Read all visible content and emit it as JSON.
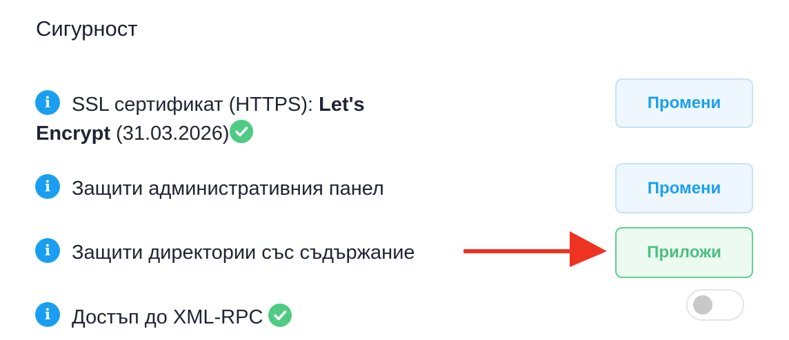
{
  "section": {
    "title": "Сигурност"
  },
  "settings": [
    {
      "label_prefix": "SSL сертификат (HTTPS): ",
      "label_bold_part1": "Let's",
      "label_bold_part2": "Encrypt",
      "label_suffix": " (31.03.2026)",
      "verified": true,
      "action_label": "Промени"
    },
    {
      "label": "Защити административния панел",
      "action_label": "Промени"
    },
    {
      "label": "Защити директории със съдържание",
      "action_label": "Приложи"
    },
    {
      "label": "Достъп до XML-RPC",
      "verified": true,
      "toggle_on": false
    }
  ],
  "icons": {
    "info": "info-icon",
    "check": "check-circle-icon",
    "arrow": "red-arrow-annotation"
  },
  "colors": {
    "accent_blue": "#1a9ff0",
    "success_green": "#4fcb84",
    "annotation_red": "#ee3322"
  }
}
